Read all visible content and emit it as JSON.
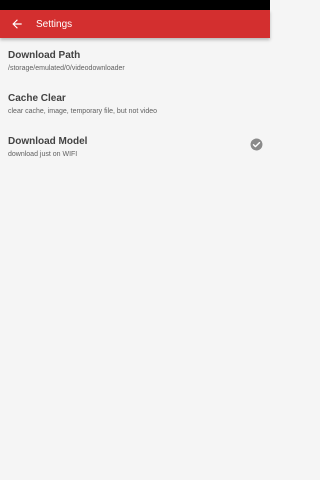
{
  "app_bar": {
    "title": "Settings",
    "back_icon": "arrow-back-icon",
    "color": "#d32f2f"
  },
  "settings": {
    "items": [
      {
        "title": "Download Path",
        "summary": "/storage/emulated/0/videodownloader"
      },
      {
        "title": "Cache Clear",
        "summary": "clear cache, image, temporary file, but not video"
      },
      {
        "title": "Download Model",
        "summary": "download just on WIFI",
        "checked": true,
        "check_icon": "check-circle-icon"
      }
    ]
  }
}
